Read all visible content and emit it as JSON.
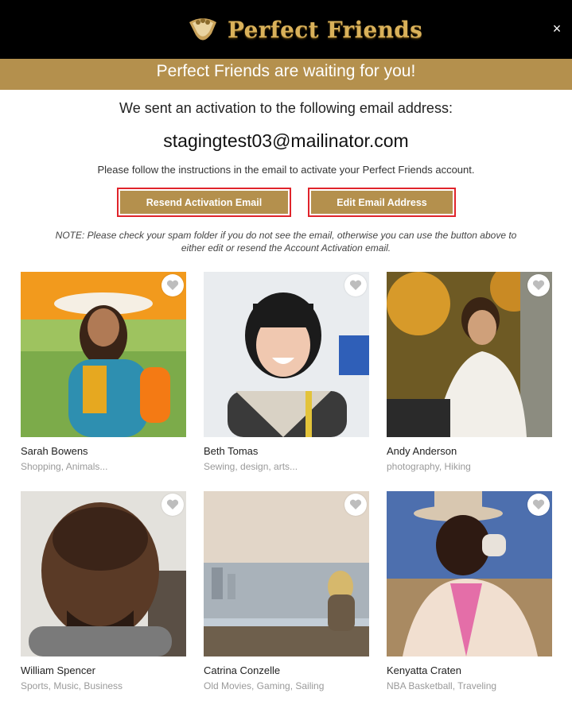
{
  "header": {
    "logo_text": "Perfect Friends",
    "close_glyph": "×"
  },
  "banner": {
    "text": "Perfect Friends are waiting for you!"
  },
  "activation": {
    "sent_message": "We sent an activation to the following email address:",
    "email": "stagingtest03@mailinator.com",
    "instructions": "Please follow the instructions in the email to activate your Perfect Friends account.",
    "resend_label": "Resend Activation Email",
    "edit_label": "Edit Email Address",
    "note": "NOTE: Please check your spam folder if you do not see the email, otherwise you can use the button above to either edit or resend the Account Activation email."
  },
  "profiles": [
    {
      "name": "Sarah Bowens",
      "interests": "Shopping, Animals..."
    },
    {
      "name": "Beth Tomas",
      "interests": "Sewing, design, arts..."
    },
    {
      "name": "Andy Anderson",
      "interests": "photography, Hiking"
    },
    {
      "name": "William Spencer",
      "interests": "Sports, Music, Business"
    },
    {
      "name": "Catrina Conzelle",
      "interests": "Old Movies, Gaming, Sailing"
    },
    {
      "name": "Kenyatta Craten",
      "interests": "NBA Basketball, Traveling"
    }
  ],
  "colors": {
    "brand_gold": "#b4904d",
    "header_bg": "#000000",
    "button_outline": "#e0242b"
  },
  "icons": {
    "heart": "heart-icon",
    "close": "close-icon",
    "logo": "logo-icon"
  }
}
